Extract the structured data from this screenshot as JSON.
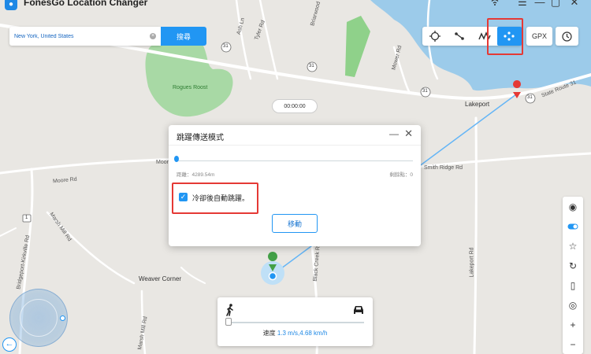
{
  "app": {
    "title": "FonesGo Location Changer"
  },
  "window": {
    "wifi_icon": "wifi-icon",
    "menu_icon": "menu-icon",
    "minimize_icon": "minimize-icon",
    "restore_icon": "restore-icon",
    "close_icon": "close-icon"
  },
  "search": {
    "value": "New York, United States",
    "button_label": "搜尋"
  },
  "toolbar": {
    "gpx_label": "GPX"
  },
  "timer": "00:00:00",
  "dialog": {
    "title": "跳躍傳送模式",
    "distance_label": "距離：4289.54m",
    "remaining_label": "剩餘點：0",
    "checkbox_label": "冷卻後自動跳躍。",
    "move_button": "移動"
  },
  "speed": {
    "label": "速度",
    "value": "1.3 m/s,4.68 km/h"
  },
  "map": {
    "place_lakeport": "Lakeport",
    "place_weaver": "Weaver Corner",
    "park": "Rogues Roost",
    "roads": {
      "state_route": "State Route 31",
      "moore_rd": "Moore Rd",
      "marsh_mill": "Marsh Mill Rd",
      "bridgeport": "Bridgeport-Kirkville Rd",
      "black_creek": "Black Creek Rd",
      "smith_ridge": "Smith Ridge Rd",
      "lakeport_rd": "Lakeport Rd",
      "tyler_rd": "Tyler Rd",
      "ash_ln": "Ash Ln",
      "mower_rd": "Mower Rd",
      "briarwood": "Briarwood"
    },
    "route_marker": "31",
    "route_marker_1": "1"
  }
}
